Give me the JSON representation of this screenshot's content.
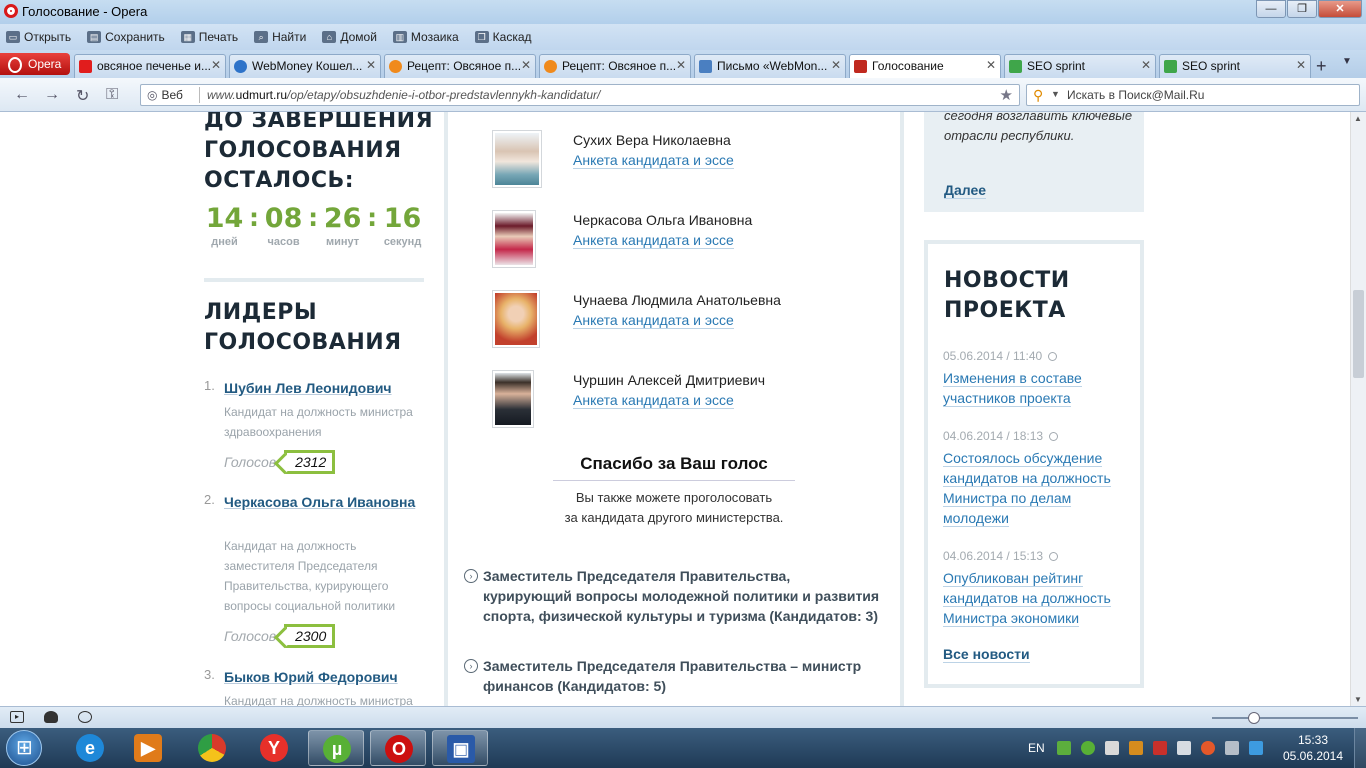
{
  "window": {
    "title": "Голосование - Opera",
    "controls": [
      "—",
      "❐",
      "✕"
    ]
  },
  "menu": [
    {
      "label": "Открыть",
      "icon": "folder-icon"
    },
    {
      "label": "Сохранить",
      "icon": "save-icon"
    },
    {
      "label": "Печать",
      "icon": "print-icon"
    },
    {
      "label": "Найти",
      "icon": "find-icon"
    },
    {
      "label": "Домой",
      "icon": "home-icon"
    },
    {
      "label": "Мозаика",
      "icon": "tile-icon"
    },
    {
      "label": "Каскад",
      "icon": "cascade-icon"
    }
  ],
  "opera_button": "Opera",
  "tabs": [
    {
      "label": "овсяное печенье и...",
      "fav_color": "#e11d1d",
      "active": false
    },
    {
      "label": "WebMoney Кошел...",
      "fav_color": "#2e73c9",
      "active": false
    },
    {
      "label": "Рецепт: Овсяное п...",
      "fav_color": "#f08a1c",
      "active": false
    },
    {
      "label": "Рецепт: Овсяное п...",
      "fav_color": "#f08a1c",
      "active": false
    },
    {
      "label": "Письмо «WebMon...",
      "fav_color": "#4a7fc1",
      "active": false
    },
    {
      "label": "Голосование",
      "fav_color": "#c0291f",
      "active": true
    },
    {
      "label": "SEO sprint",
      "fav_color": "#3fa64a",
      "active": false
    },
    {
      "label": "SEO sprint",
      "fav_color": "#3fa64a",
      "active": false
    }
  ],
  "address": {
    "web_label": "Веб",
    "url_prefix": "www.",
    "url_domain": "udmurt.ru",
    "url_path": "/op/etapy/obsuzhdenie-i-otbor-predstavlennykh-kandidatur/",
    "search_placeholder": "Искать в Поиск@Mail.Ru"
  },
  "timer": {
    "heading": "ДО ЗАВЕРШЕНИЯ ГОЛОСОВАНИЯ ОСТАЛОСЬ:",
    "units": [
      {
        "value": "14",
        "label": "дней"
      },
      {
        "value": "08",
        "label": "часов"
      },
      {
        "value": "26",
        "label": "минут"
      },
      {
        "value": "16",
        "label": "секунд"
      }
    ]
  },
  "leaders": {
    "heading": "ЛИДЕРЫ ГОЛОСОВАНИЯ",
    "votes_label": "Голосов",
    "items": [
      {
        "index": "1.",
        "name": "Шубин Лев Леонидович",
        "desc": "Кандидат на должность министра здравоохранения",
        "votes": "2312"
      },
      {
        "index": "2.",
        "name": "Черкасова Ольга Ивановна",
        "desc": "Кандидат на должность заместителя Председателя Правительства, курирующего вопросы социальной политики",
        "votes": "2300"
      },
      {
        "index": "3.",
        "name": "Быков Юрий Федорович",
        "desc": "Кандидат на должность министра",
        "votes": ""
      }
    ]
  },
  "candidates": {
    "link_label": "Анкета кандидата и эссе",
    "items": [
      {
        "name": "Сухих Вера Николаевна"
      },
      {
        "name": "Черкасова Ольга Ивановна"
      },
      {
        "name": "Чунаева Людмила Анатольевна"
      },
      {
        "name": "Чуршин Алексей Дмитриевич"
      }
    ]
  },
  "thanks": {
    "title": "Спасибо за Ваш голос",
    "line1": "Вы также можете проголосовать",
    "line2": "за кандидата другого министерства."
  },
  "ministries": [
    {
      "text": "Заместитель Председателя Правительства, курирующий вопросы молодежной политики и развития спорта, физической культуры и туризма (Кандидатов: 3)"
    },
    {
      "text": "Заместитель Председателя Правительства – министр финансов (Кандидатов: 5)"
    }
  ],
  "prev_block": {
    "text": "сегодня возглавить ключевые отрасли республики.",
    "more": "Далее"
  },
  "news": {
    "heading": "НОВОСТИ ПРОЕКТА",
    "all_label": "Все новости",
    "items": [
      {
        "date": "05.06.2014 / 11:40",
        "title": "Изменения в составе участников проекта"
      },
      {
        "date": "04.06.2014 / 18:13",
        "title": "Состоялось обсуждение кандидатов на должность Министра по делам молодежи"
      },
      {
        "date": "04.06.2014 / 15:13",
        "title": "Опубликован рейтинг кандидатов на должность Министра экономики"
      }
    ]
  },
  "taskbar": {
    "lang": "EN",
    "time": "15:33",
    "date": "05.06.2014",
    "apps": [
      {
        "name": "ie-icon",
        "color": "#1e88d8",
        "glyph": "e"
      },
      {
        "name": "media-player-icon",
        "color": "#e07b1a",
        "glyph": "▶"
      },
      {
        "name": "chrome-icon",
        "color": "#d93a2b",
        "glyph": "◉"
      },
      {
        "name": "yandex-browser-icon",
        "color": "#e7302a",
        "glyph": "Y"
      },
      {
        "name": "utorrent-icon",
        "color": "#58b036",
        "glyph": "µ"
      },
      {
        "name": "opera-icon",
        "color": "#cc1010",
        "glyph": "O"
      },
      {
        "name": "floppy-icon",
        "color": "#2a5aa8",
        "glyph": "▣"
      }
    ]
  }
}
